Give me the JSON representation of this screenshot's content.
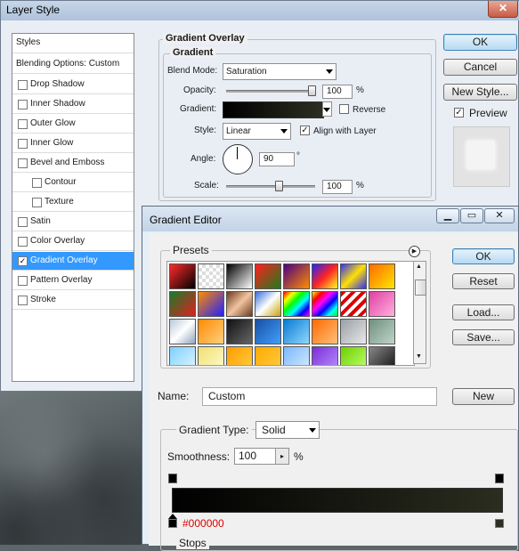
{
  "layer_style": {
    "title": "Layer Style",
    "close_label": "✕",
    "styles_list": [
      {
        "label": "Styles",
        "checkbox": false,
        "checked": false,
        "indent": 0
      },
      {
        "label": "Blending Options: Custom",
        "checkbox": false,
        "checked": false,
        "indent": 0
      },
      {
        "label": "Drop Shadow",
        "checkbox": true,
        "checked": false,
        "indent": 0
      },
      {
        "label": "Inner Shadow",
        "checkbox": true,
        "checked": false,
        "indent": 0
      },
      {
        "label": "Outer Glow",
        "checkbox": true,
        "checked": false,
        "indent": 0
      },
      {
        "label": "Inner Glow",
        "checkbox": true,
        "checked": false,
        "indent": 0
      },
      {
        "label": "Bevel and Emboss",
        "checkbox": true,
        "checked": false,
        "indent": 0
      },
      {
        "label": "Contour",
        "checkbox": true,
        "checked": false,
        "indent": 1
      },
      {
        "label": "Texture",
        "checkbox": true,
        "checked": false,
        "indent": 1
      },
      {
        "label": "Satin",
        "checkbox": true,
        "checked": false,
        "indent": 0
      },
      {
        "label": "Color Overlay",
        "checkbox": true,
        "checked": false,
        "indent": 0
      },
      {
        "label": "Gradient Overlay",
        "checkbox": true,
        "checked": true,
        "indent": 0,
        "selected": true
      },
      {
        "label": "Pattern Overlay",
        "checkbox": true,
        "checked": false,
        "indent": 0
      },
      {
        "label": "Stroke",
        "checkbox": true,
        "checked": false,
        "indent": 0
      }
    ],
    "group_title": "Gradient Overlay",
    "sub_title": "Gradient",
    "blend_mode_label": "Blend Mode:",
    "blend_mode_value": "Saturation",
    "opacity_label": "Opacity:",
    "opacity_value": "100",
    "opacity_unit": "%",
    "opacity_level": 1.0,
    "gradient_label": "Gradient:",
    "reverse_label": "Reverse",
    "reverse_checked": false,
    "style_label": "Style:",
    "style_value": "Linear",
    "align_label": "Align with Layer",
    "align_checked": true,
    "angle_label": "Angle:",
    "angle_value": "90",
    "angle_unit": "°",
    "scale_label": "Scale:",
    "scale_value": "100",
    "scale_unit": "%",
    "scale_level": 0.6,
    "ok_label": "OK",
    "cancel_label": "Cancel",
    "new_style_label": "New Style...",
    "preview_label": "Preview",
    "preview_checked": true
  },
  "gradient_editor": {
    "title": "Gradient Editor",
    "presets_label": "Presets",
    "ok_label": "OK",
    "reset_label": "Reset",
    "load_label": "Load...",
    "save_label": "Save...",
    "name_label": "Name:",
    "name_value": "Custom",
    "new_label": "New",
    "gradient_type_label": "Gradient Type:",
    "gradient_type_value": "Solid",
    "smoothness_label": "Smoothness:",
    "smoothness_value": "100",
    "smoothness_unit": "%",
    "stop_color_text": "#000000",
    "stops_label": "Stops",
    "preset_gradients": [
      "linear-gradient(135deg,#ff2a2a,#000)",
      "repeating-conic-gradient(#ddd 0 25%,#fff 0 50%)",
      "linear-gradient(135deg,#000,#fff)",
      "linear-gradient(135deg,#ff2020,#1e7b1e)",
      "linear-gradient(135deg,#4b0082,#ff8c00)",
      "linear-gradient(135deg,#2222ff,#ff2222,#ffff22)",
      "linear-gradient(135deg,#3030ff,#ffe000,#3030ff)",
      "linear-gradient(135deg,#ff6a00,#ffe600)",
      "linear-gradient(135deg,#1a7a2a,#e02020)",
      "linear-gradient(135deg,#ff8c00,#2020ff)",
      "linear-gradient(135deg,#6b3a1e,#f3c3a0,#6b3a1e)",
      "linear-gradient(135deg,#3a6fd8,#fff,#c9a000)",
      "linear-gradient(135deg,#ff0000,#ff0,#0f0,#0ff,#00f,#f0f)",
      "linear-gradient(135deg,#ff0,#f00,#f0f,#00f,#0ff,#0f0)",
      "repeating-linear-gradient(135deg,#d00 0 4px,#fff 4px 8px)",
      "linear-gradient(135deg,#e040a0,#ffb0e0)",
      "linear-gradient(135deg,#b8c8d8,#fff,#8fa4bb)",
      "linear-gradient(135deg,#ff8a00,#ffd080)",
      "linear-gradient(135deg,#111,#666)",
      "linear-gradient(135deg,#1a4fa0,#3fa0ff)",
      "linear-gradient(135deg,#0a7ad0,#8fd8ff)",
      "linear-gradient(135deg,#ff6a00,#ffc07a)",
      "linear-gradient(135deg,#9aa0a6,#e8e8e8)",
      "linear-gradient(135deg,#6f8f7f,#c0d4c8)",
      "linear-gradient(135deg,#7fd0ff,#e0f6ff)",
      "linear-gradient(135deg,#f0e070,#fffbd0)",
      "linear-gradient(135deg,#ff9a00,#ffd040)",
      "linear-gradient(135deg,#ffaa00,#ffcc44)",
      "linear-gradient(135deg,#7ab8ff,#d8ecff)",
      "linear-gradient(135deg,#7a2ed8,#b890ff)",
      "linear-gradient(135deg,#6ed000,#c0ff70)",
      "linear-gradient(135deg,#888,#111)"
    ]
  }
}
